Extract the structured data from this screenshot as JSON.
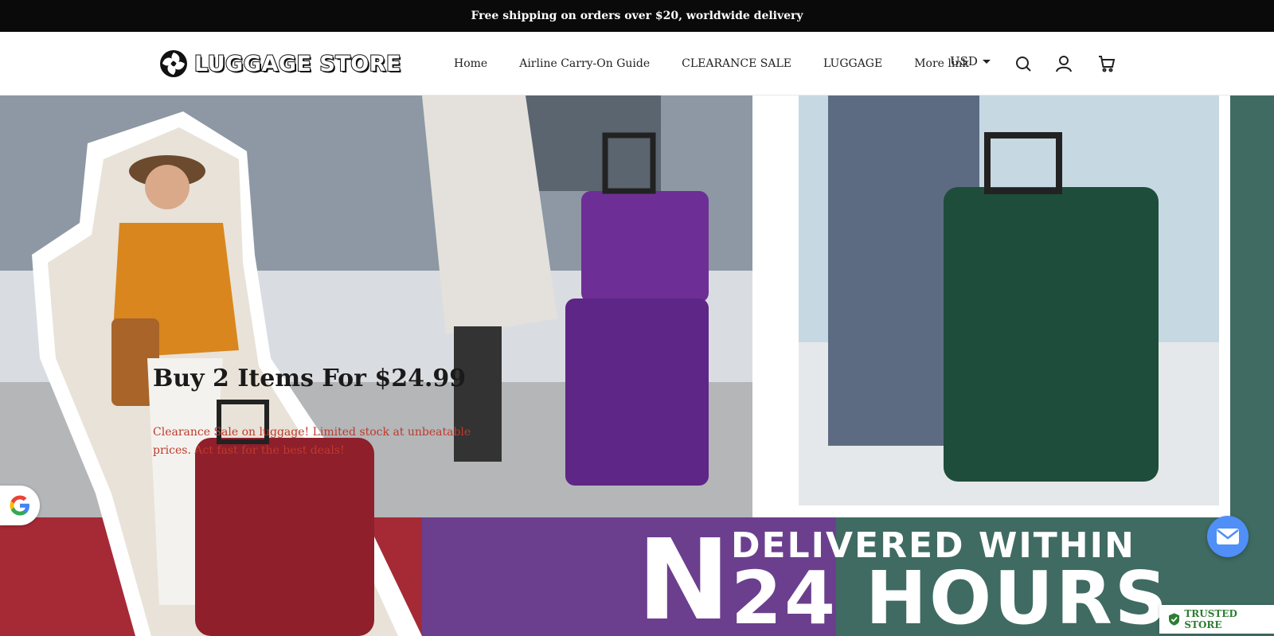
{
  "announcement": "Free shipping on orders over $20, worldwide delivery",
  "logo": {
    "text": "LUGGAGE STORE"
  },
  "nav": {
    "items": [
      "Home",
      "Airline Carry-On Guide",
      "CLEARANCE SALE",
      "LUGGAGE",
      "More link"
    ]
  },
  "currency": "USD",
  "icons": [
    "search-icon",
    "account-icon",
    "cart-icon",
    "google-icon",
    "mail-icon",
    "shield-check-icon"
  ],
  "hero": {
    "title": "Buy 2 Items For $24.99",
    "subtitle": "Clearance Sale on luggage! Limited stock at unbeatable prices. Act fast for the best deals!",
    "banner_line1": "DELIVERED WITHIN",
    "banner_line2": "24 HOURS",
    "banner_letter": "N"
  },
  "badges": {
    "trusted": "TRUSTED STORE"
  },
  "colors": {
    "announce_bg": "#0a0a0a",
    "purple": "#6b3f8e",
    "teal": "#3f6b62",
    "red": "#a52a36",
    "mail_blue": "#4f8ff7",
    "trusted_green": "#2e7d32"
  }
}
